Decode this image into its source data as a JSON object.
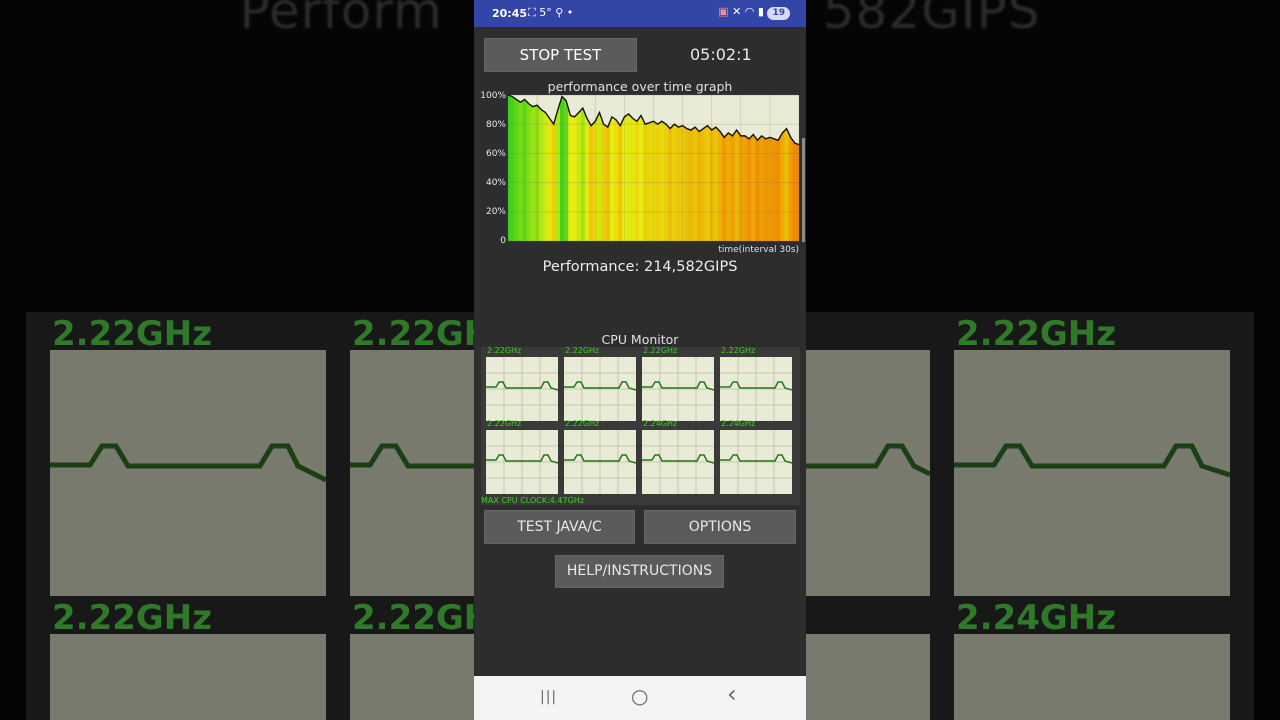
{
  "background": {
    "title_fragment_left": "Perform",
    "title_fragment_right": "582GIPS",
    "clock_labels": [
      "2.22GHz",
      "2.22GHz",
      "2.22GHz",
      "2.22GHz",
      "2.22GHz",
      "2.24GHz"
    ]
  },
  "status_bar": {
    "time": "20:45",
    "temperature": "5°",
    "battery": "19",
    "icons": [
      "screen-record-icon",
      "search-icon",
      "dot-icon",
      "cast-icon",
      "mute-icon",
      "wifi-icon",
      "signal-icon",
      "battery-icon"
    ]
  },
  "controls": {
    "stop_label": "STOP TEST",
    "timer": "05:02:1"
  },
  "graph": {
    "title": "performance over time graph",
    "y_ticks": [
      "100%",
      "80%",
      "60%",
      "40%",
      "20%",
      "0"
    ],
    "x_label": "time(interval 30s)",
    "values": [
      100,
      99,
      97,
      95,
      97,
      94,
      92,
      93,
      90,
      88,
      84,
      80,
      90,
      99,
      96,
      86,
      85,
      88,
      91,
      84,
      79,
      82,
      88,
      80,
      78,
      85,
      83,
      79,
      85,
      87,
      84,
      82,
      86,
      80,
      81,
      82,
      80,
      82,
      80,
      77,
      80,
      78,
      79,
      77,
      76,
      78,
      75,
      77,
      79,
      76,
      78,
      75,
      71,
      74,
      72,
      76,
      72,
      72,
      70,
      73,
      69,
      72,
      70,
      71,
      70,
      69,
      74,
      77,
      71,
      67,
      66
    ],
    "colors": {
      "high": "#3ad01a",
      "mid": "#e8ef10",
      "low": "#f08a00",
      "grid_bg": "#e9ebd6",
      "line": "#111111"
    }
  },
  "performance": {
    "label": "Performance: 214,582GIPS"
  },
  "cpu_monitor": {
    "title": "CPU Monitor",
    "cores": [
      {
        "clock": "2.22GHz"
      },
      {
        "clock": "2.22GHz"
      },
      {
        "clock": "2.22GHz"
      },
      {
        "clock": "2.22GHz"
      },
      {
        "clock": "2.22GHz"
      },
      {
        "clock": "2.22GHz"
      },
      {
        "clock": "2.24GHz"
      },
      {
        "clock": "2.24GHz"
      }
    ],
    "max_clock": "MAX CPU CLOCK:4.47GHz",
    "trace_color": "#1f7a14"
  },
  "buttons": {
    "test_java": "TEST JAVA/C",
    "options": "OPTIONS",
    "help": "HELP/INSTRUCTIONS"
  },
  "nav_bar": {
    "recents": "|||",
    "home": "○",
    "back": "‹"
  }
}
